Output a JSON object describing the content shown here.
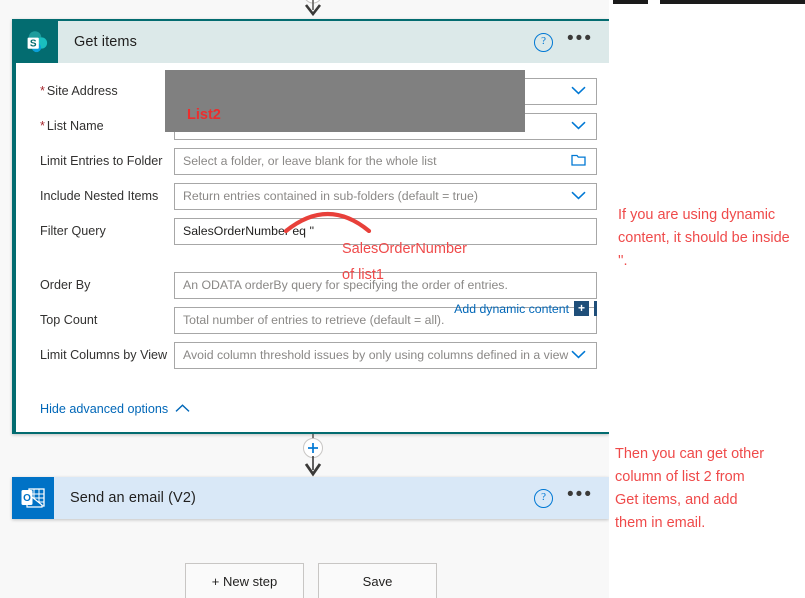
{
  "flow": {
    "get_items": {
      "title": "Get items",
      "icon": "sharepoint-icon",
      "help_icon": "?",
      "more_icon": "•••",
      "fields": [
        {
          "label": "Site Address",
          "required": true,
          "value": "",
          "placeholder": "",
          "control": "dropdown"
        },
        {
          "label": "List Name",
          "required": true,
          "value": "",
          "placeholder": "",
          "control": "dropdown"
        },
        {
          "label": "Limit Entries to Folder",
          "required": false,
          "value": "",
          "placeholder": "Select a folder, or leave blank for the whole list",
          "control": "folder-picker"
        },
        {
          "label": "Include Nested Items",
          "required": false,
          "value": "",
          "placeholder": "Return entries contained in sub-folders (default = true)",
          "control": "dropdown"
        },
        {
          "label": "Filter Query",
          "required": false,
          "value": "SalesOrderNumber eq ''",
          "placeholder": "",
          "control": "text"
        },
        {
          "label": "Order By",
          "required": false,
          "value": "",
          "placeholder": "An ODATA orderBy query for specifying the order of entries.",
          "control": "text"
        },
        {
          "label": "Top Count",
          "required": false,
          "value": "",
          "placeholder": "Total number of entries to retrieve (default = all).",
          "control": "text"
        },
        {
          "label": "Limit Columns by View",
          "required": false,
          "value": "",
          "placeholder": "Avoid column threshold issues by only using columns defined in a view",
          "control": "dropdown"
        }
      ],
      "dynamic_content_link": "Add dynamic content",
      "dynamic_content_plus": "+",
      "hide_advanced": "Hide advanced options",
      "redaction_label": "List2"
    },
    "send_email": {
      "title": "Send an email (V2)",
      "icon": "outlook-icon",
      "help_icon": "?",
      "more_icon": "•••"
    },
    "buttons": {
      "new_step": "+ New step",
      "save": "Save"
    },
    "connector_plus": "+"
  },
  "annotations": {
    "dynamic_note": "If you are using dynamic content, it should be inside ''.",
    "then_note": "Then you can get other column of list 2 from Get items, and add them in email.",
    "sales_note": "SalesOrderNumber of list1"
  },
  "colors": {
    "sharepoint_teal": "#036c70",
    "outlook_blue": "#0072c6",
    "link_blue": "#0067b8",
    "annotation_red": "#ef4a4a",
    "redaction_gray": "#808080",
    "required_red": "#a4262c"
  }
}
